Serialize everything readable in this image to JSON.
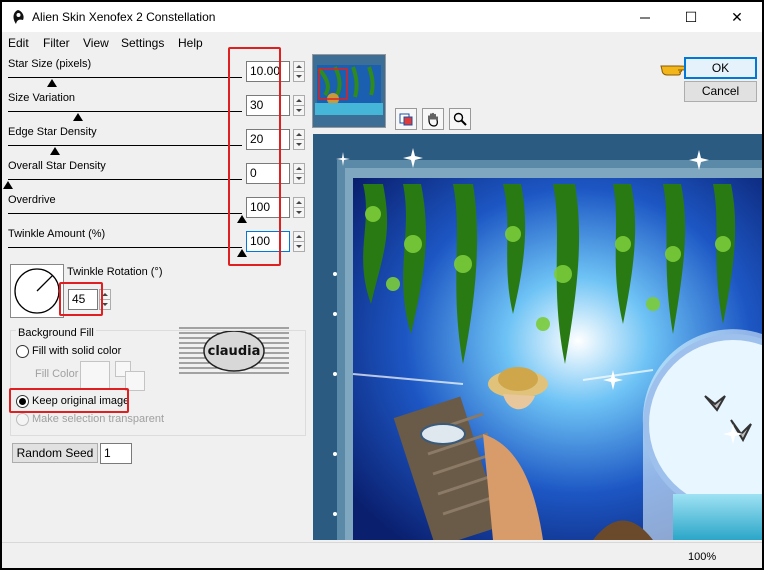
{
  "window": {
    "title": "Alien Skin Xenofex 2 Constellation",
    "maximize_glyph": "☐",
    "close_glyph": "✕"
  },
  "menu": [
    "Edit",
    "Filter",
    "View",
    "Settings",
    "Help"
  ],
  "sliders": [
    {
      "label": "Star Size (pixels)",
      "value": "10.00",
      "level": 0.19
    },
    {
      "label": "Size Variation",
      "value": "30",
      "level": 0.3
    },
    {
      "label": "Edge Star Density",
      "value": "20",
      "level": 0.2
    },
    {
      "label": "Overall Star Density",
      "value": "0",
      "level": 0.0
    },
    {
      "label": "Overdrive",
      "value": "100",
      "level": 1.0
    },
    {
      "label": "Twinkle Amount (%)",
      "value": "100",
      "level": 1.0
    }
  ],
  "twinkle_rotation": {
    "label": "Twinkle Rotation (°)",
    "value": "45"
  },
  "background_fill": {
    "title": "Background Fill",
    "option_solid": "Fill with solid color",
    "fill_color_label": "Fill Color",
    "option_keep": "Keep original image",
    "option_transparent": "Make selection transparent",
    "selected": "keep"
  },
  "watermark_text": "claudia",
  "random_seed": {
    "button": "Random Seed",
    "value": "1"
  },
  "buttons": {
    "ok": "OK",
    "cancel": "Cancel"
  },
  "tools": {
    "compare_icon": "compare-icon",
    "hand_icon": "hand-icon",
    "zoom_icon": "magnifier-icon"
  },
  "status": {
    "zoom": "100%"
  },
  "colors": {
    "highlight": "#e02020",
    "pointer_hand": "#f2b51a",
    "canvas_frame": "#2c5b82"
  }
}
